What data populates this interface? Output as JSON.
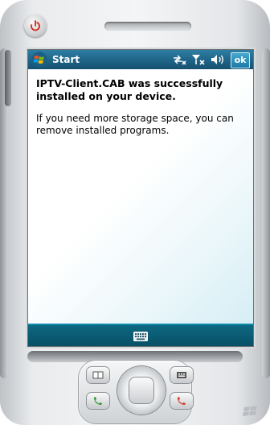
{
  "status_bar": {
    "start_label": "Start",
    "ok_label": "ok",
    "icons": [
      "connectivity-icon",
      "signal-off-icon",
      "volume-icon"
    ]
  },
  "message": {
    "title": "IPTV-Client.CAB was successfully installed on your device.",
    "body": "If you need more storage space, you can remove installed programs."
  },
  "soft_key_bar": {
    "center_icon": "keyboard-icon"
  },
  "colors": {
    "title_bar": "#1f6689",
    "soft_key_bar": "#0d6882",
    "power_icon": "#d0281c",
    "call_green": "#2e9b2a",
    "end_red": "#d23a2a"
  }
}
